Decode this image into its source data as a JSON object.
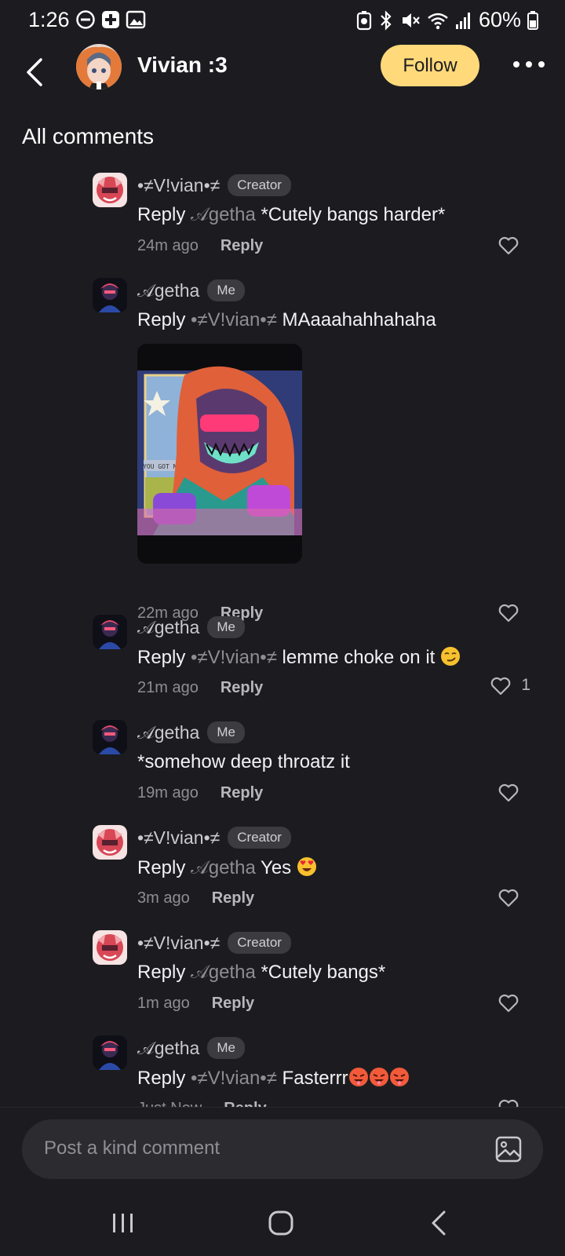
{
  "status_bar": {
    "time": "1:26",
    "battery": "60%",
    "icons": [
      "do-not-disturb-icon",
      "app-notification-icon",
      "gallery-icon",
      "battery-saver-icon",
      "bluetooth-icon",
      "mute-icon",
      "wifi-icon",
      "signal-icon",
      "battery-icon"
    ]
  },
  "header": {
    "profile_name": "Vivian :3",
    "follow_label": "Follow"
  },
  "section_title": "All comments",
  "comments": [
    {
      "user": "•≠V!vian•≠",
      "badge": "Creator",
      "prefix": "Reply ",
      "mention": "𝒜getha",
      "text": " *Cutely bangs harder*",
      "time": "24m ago",
      "reply": "Reply",
      "likes": ""
    },
    {
      "user": "𝒜getha",
      "badge": "Me",
      "prefix": "Reply ",
      "mention": "•≠V!vian•≠",
      "text": " MAaaahahhahaha",
      "time": "22m ago",
      "reply": "Reply",
      "likes": "",
      "image_text": "YOU GOT MAIL"
    },
    {
      "user": "𝒜getha",
      "badge": "Me",
      "prefix": "Reply ",
      "mention": "•≠V!vian•≠",
      "text": " lemme choke on it ",
      "time": "21m ago",
      "reply": "Reply",
      "likes": "1"
    },
    {
      "user": "𝒜getha",
      "badge": "Me",
      "prefix": "",
      "mention": "",
      "text": "*somehow deep throatz it",
      "time": "19m ago",
      "reply": "Reply",
      "likes": ""
    },
    {
      "user": "•≠V!vian•≠",
      "badge": "Creator",
      "prefix": "Reply ",
      "mention": "𝒜getha",
      "text": " Yes ",
      "time": "3m ago",
      "reply": "Reply",
      "likes": ""
    },
    {
      "user": "•≠V!vian•≠",
      "badge": "Creator",
      "prefix": "Reply ",
      "mention": "𝒜getha",
      "text": " *Cutely bangs*",
      "time": "1m ago",
      "reply": "Reply",
      "likes": ""
    },
    {
      "user": "𝒜getha",
      "badge": "Me",
      "prefix": "Reply ",
      "mention": "•≠V!vian•≠",
      "text": " Fasterrr",
      "time": "Just Now",
      "reply": "Reply",
      "likes": ""
    }
  ],
  "comment_input": {
    "placeholder": "Post a kind comment"
  },
  "colors": {
    "background": "#1c1c20",
    "follow_button": "#ffd97a",
    "mention": "#8d8d94"
  }
}
